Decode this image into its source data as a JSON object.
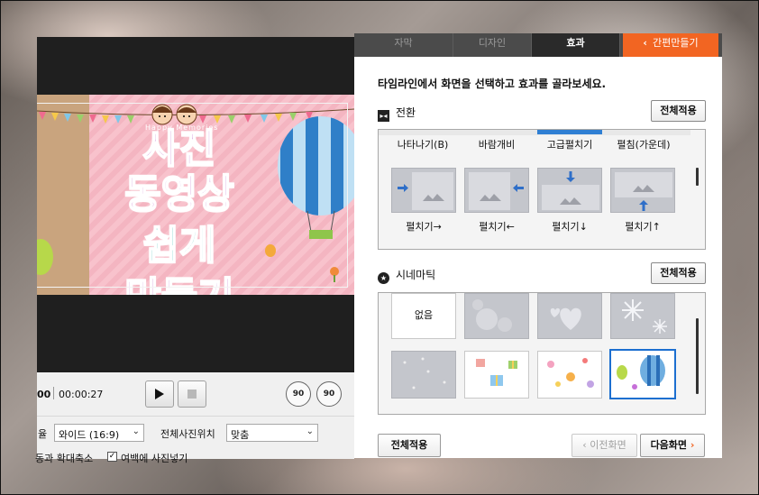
{
  "tabs": [
    {
      "label": "자막",
      "active": false
    },
    {
      "label": "디자인",
      "active": false
    },
    {
      "label": "효과",
      "active": true
    }
  ],
  "back_button": {
    "label": "간편만들기",
    "icon": "chevron-left-icon"
  },
  "instruction": "타임라인에서 화면을 선택하고 효과를 골라보세요.",
  "transition": {
    "title": "전환",
    "apply_all": "전체적용",
    "top_row_labels": [
      "나타나기(B)",
      "바람개비",
      "고급펼치기",
      "펼침(가운데)"
    ],
    "items": [
      {
        "label": "펼치기→",
        "icon": "arrow-right-icon"
      },
      {
        "label": "펼치기←",
        "icon": "arrow-left-icon"
      },
      {
        "label": "펼치기↓",
        "icon": "arrow-down-icon"
      },
      {
        "label": "펼치기↑",
        "icon": "arrow-up-icon"
      }
    ]
  },
  "cinematic": {
    "title": "시네마틱",
    "apply_all": "전체적용",
    "items": [
      {
        "label": "없음"
      },
      {
        "label": "",
        "icon": "bokeh-icon"
      },
      {
        "label": "",
        "icon": "hearts-icon"
      },
      {
        "label": "",
        "icon": "snowflake-icon"
      },
      {
        "label": "",
        "icon": "dots-icon"
      },
      {
        "label": "",
        "icon": "gift-box-icon"
      },
      {
        "label": "",
        "icon": "flowers-icon"
      },
      {
        "label": "",
        "icon": "balloon-icon",
        "selected": true
      }
    ]
  },
  "bottom": {
    "apply_all": "전체적용",
    "prev": "이전화면",
    "next": "다음화면"
  },
  "preview": {
    "lines": [
      "사진",
      "동영상",
      "쉽게",
      "만들기"
    ],
    "happy": "Happy Memories"
  },
  "player": {
    "time_current": "00",
    "time_total": "00:00:27",
    "rotate_left": "90",
    "rotate_right": "90"
  },
  "options": {
    "ratio_label": "율",
    "ratio_value": "와이드 (16:9)",
    "position_label": "전체사진위치",
    "position_value": "맞춤",
    "checkbox1_label": "동과 확대축소",
    "checkbox2_label": "여백에 사진넣기"
  },
  "colors": {
    "accent_orange": "#f26522",
    "tab_bg": "#4b4b4b",
    "selected_border": "#1c6fd0"
  }
}
